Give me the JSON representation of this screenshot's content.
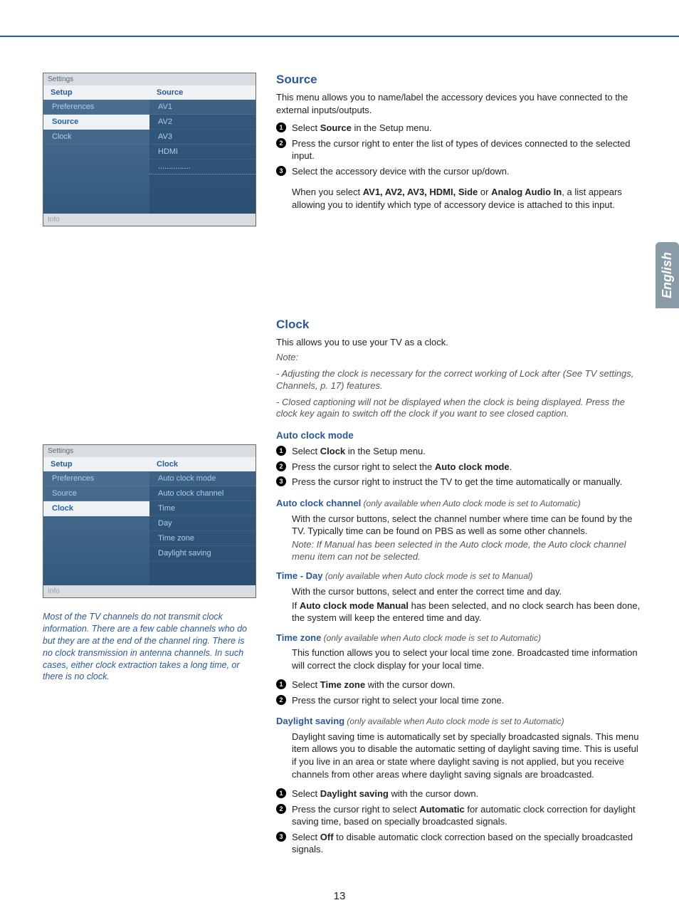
{
  "lang_tab": "English",
  "page_number": "13",
  "menu1": {
    "title": "Settings",
    "head_left": "Setup",
    "head_right": "Source",
    "left_items": [
      "Preferences",
      "Source",
      "Clock"
    ],
    "left_selected_index": 1,
    "right_items": [
      "AV1",
      "AV2",
      "AV3",
      "HDMI",
      "..............."
    ],
    "info": "Info"
  },
  "menu2": {
    "title": "Settings",
    "head_left": "Setup",
    "head_right": "Clock",
    "left_items": [
      "Preferences",
      "Source",
      "Clock"
    ],
    "left_selected_index": 2,
    "right_items": [
      "Auto clock mode",
      "Auto clock channel",
      "Time",
      "Day",
      "Time zone",
      "Daylight saving"
    ],
    "info": "Info"
  },
  "side_note": "Most of the TV channels do not transmit clock information. There are a few cable channels who do but they are at the end of the channel ring. There is no clock transmission in antenna channels. In such cases, either clock extraction takes a long time, or there is no clock.",
  "source": {
    "heading": "Source",
    "intro": "This menu allows you to name/label the accessory devices you have connected to the external inputs/outputs.",
    "step1_pre": "Select ",
    "step1_b": "Source",
    "step1_post": " in the Setup menu.",
    "step2": "Press the cursor right to enter the list of types of devices connected to the selected input.",
    "step3": "Select the accessory device with the cursor up/down.",
    "result_pre": "When you select ",
    "result_b1": "AV1, AV2, AV3, HDMI, Side",
    "result_mid": " or ",
    "result_b2": "Analog Audio In",
    "result_post": ", a list appears allowing you to identify which type of accessory device is attached to this input."
  },
  "clock": {
    "heading": "Clock",
    "intro": "This allows you to use your TV as a clock.",
    "note_label": "Note:",
    "note1": "- Adjusting the clock is necessary for the correct working of Lock after (See TV settings, Channels, p. 17) features.",
    "note2": "- Closed captioning will not be displayed when the clock is being displayed. Press the clock key again to switch off the clock if you want to see closed caption.",
    "auto_mode": {
      "heading": "Auto clock mode",
      "step1_pre": "Select ",
      "step1_b": "Clock",
      "step1_post": " in the Setup menu.",
      "step2_pre": "Press the cursor right to select the ",
      "step2_b": "Auto clock mode",
      "step2_post": ".",
      "step3": "Press the cursor right to instruct the TV to get the time automatically or manually."
    },
    "auto_channel": {
      "label": "Auto clock channel",
      "qual": " (only available when Auto clock mode is set to Automatic)",
      "body": "With the cursor buttons, select the channel number where time can be found by the TV. Typically time can be found on PBS as well as some other channels.",
      "note": "Note: If Manual has been selected in the Auto clock mode, the Auto clock channel menu item can not be selected."
    },
    "time_day": {
      "label": "Time - Day",
      "qual": " (only available when Auto clock mode is set to Manual)",
      "line1": "With the cursor buttons, select and enter the correct time and day.",
      "line2_pre": "If ",
      "line2_b": "Auto clock mode Manual",
      "line2_post": " has been selected, and no clock search has been done, the system will keep the entered time and day."
    },
    "time_zone": {
      "label": "Time zone",
      "qual": " (only available when Auto clock mode is set to Automatic)",
      "body": "This function allows you to select your local time zone. Broadcasted time information will correct the clock display for your local time.",
      "step1_pre": "Select ",
      "step1_b": "Time zone",
      "step1_post": " with the cursor down.",
      "step2": "Press the cursor right to select your local time zone."
    },
    "daylight": {
      "label": "Daylight saving",
      "qual": " (only available when Auto clock mode is set to Automatic)",
      "body": "Daylight saving time is automatically set by specially broadcasted signals. This menu item allows you to disable the automatic setting of daylight saving time. This is useful if you live in an area or state where daylight saving is not applied, but you receive channels from other areas where daylight saving signals are broadcasted.",
      "step1_pre": "Select ",
      "step1_b": "Daylight saving",
      "step1_post": " with the cursor down.",
      "step2_pre": "Press the cursor right to select ",
      "step2_b": "Automatic",
      "step2_post": " for automatic clock correction for daylight saving time, based on specially broadcasted signals.",
      "step3_pre": "Select ",
      "step3_b": "Off",
      "step3_post": " to disable automatic clock correction based on the specially broadcasted signals."
    }
  }
}
